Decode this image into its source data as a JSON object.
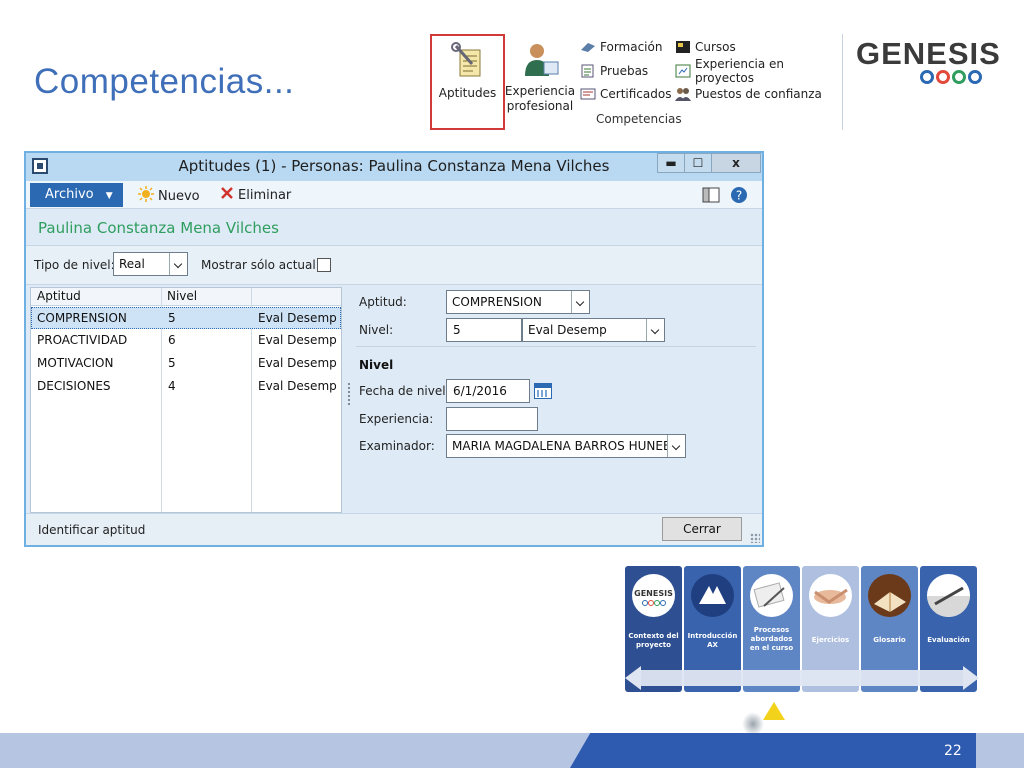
{
  "slide": {
    "title": "Competencias...",
    "page_number": "22"
  },
  "ribbon": {
    "aptitudes": "Aptitudes",
    "experiencia_line1": "Experiencia",
    "experiencia_line2": "profesional",
    "formacion": "Formación",
    "pruebas": "Pruebas",
    "certificados": "Certificados",
    "cursos": "Cursos",
    "experiencia_proyectos": "Experiencia en proyectos",
    "puestos_confianza": "Puestos de confianza",
    "group_label": "Competencias"
  },
  "logo": {
    "text": "GENESIS",
    "ring_colors": [
      "#2b6ab3",
      "#e2493b",
      "#2f9d5e",
      "#2b6ab3"
    ]
  },
  "window": {
    "title": "Aptitudes (1) - Personas: Paulina Constanza Mena  Vilches",
    "min_glyph": "▬",
    "max_glyph": "☐",
    "close_glyph": "x",
    "toolbar": {
      "archivo": "Archivo",
      "nuevo": "Nuevo",
      "eliminar": "Eliminar"
    },
    "person_name": "Paulina Constanza Mena  Vilches",
    "filter": {
      "tipo_nivel_label": "Tipo de nivel:",
      "tipo_nivel_value": "Real",
      "mostrar_actual_label": "Mostrar sólo actual:"
    },
    "grid": {
      "columns": [
        "Aptitud",
        "Nivel"
      ],
      "rows": [
        {
          "aptitud": "COMPRENSION",
          "nivel": "5",
          "desc": "Eval Desemp"
        },
        {
          "aptitud": "PROACTIVIDAD",
          "nivel": "6",
          "desc": "Eval Desemp"
        },
        {
          "aptitud": "MOTIVACION",
          "nivel": "5",
          "desc": "Eval Desemp"
        },
        {
          "aptitud": "DECISIONES",
          "nivel": "4",
          "desc": "Eval Desemp"
        }
      ]
    },
    "detail": {
      "aptitud_label": "Aptitud:",
      "aptitud_value": "COMPRENSION",
      "nivel_label": "Nivel:",
      "nivel_value": "5",
      "nivel_desc": "Eval Desemp",
      "section_nivel": "Nivel",
      "fecha_label": "Fecha de nivel:",
      "fecha_value": "6/1/2016",
      "experiencia_label": "Experiencia:",
      "experiencia_value": "",
      "examinador_label": "Examinador:",
      "examinador_value": "MARIA MAGDALENA BARROS HUNEE"
    },
    "status_text": "Identificar aptitud",
    "cerrar": "Cerrar"
  },
  "nav_tiles": [
    {
      "label": "Contexto del proyecto",
      "color": "#2e4f91",
      "icon": "genesis-logo-icon"
    },
    {
      "label": "Introducción AX",
      "color": "#3964ad",
      "icon": "dynamics-ax-icon"
    },
    {
      "label": "Procesos abordados en el curso",
      "color": "#5f86c4",
      "icon": "documents-icon"
    },
    {
      "label": "Ejercicios",
      "color": "#aebfdf",
      "icon": "handshake-icon"
    },
    {
      "label": "Glosario",
      "color": "#5f86c4",
      "icon": "book-icon"
    },
    {
      "label": "Evaluación",
      "color": "#3964ad",
      "icon": "pen-icon"
    }
  ]
}
